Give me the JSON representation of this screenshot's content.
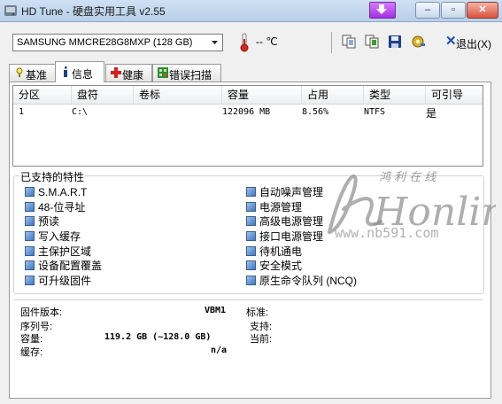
{
  "window": {
    "title": "HD Tune - 硬盘实用工具 v2.55",
    "caption_buttons": {
      "minimize": "–",
      "maximize": "▫",
      "close": "✕"
    }
  },
  "toolbar": {
    "drive": "SAMSUNG MMCRE28G8MXP (128 GB)",
    "temperature": "-- ℃",
    "exit_label": "退出(X)",
    "icons": [
      "copy-icon",
      "copy-all-icon",
      "save-icon",
      "options-icon"
    ]
  },
  "tabs": [
    {
      "label": "基准",
      "icon": "benchmark-icon"
    },
    {
      "label": "信息",
      "icon": "info-icon"
    },
    {
      "label": "健康",
      "icon": "health-icon"
    },
    {
      "label": "错误扫描",
      "icon": "error-scan-icon"
    }
  ],
  "partitions": {
    "headers": [
      "分区",
      "盘符",
      "卷标",
      "容量",
      "占用",
      "类型",
      "可引导"
    ],
    "rows": [
      [
        "1",
        "C:\\",
        "",
        "122096 MB",
        "8.56%",
        "NTFS",
        "是"
      ]
    ]
  },
  "features": {
    "title": "已支持的特性",
    "left": [
      "S.M.A.R.T",
      "48-位寻址",
      "预读",
      "写入缓存",
      "主保护区域",
      "设备配置覆盖",
      "可升级固件"
    ],
    "right": [
      "自动噪声管理",
      "电源管理",
      "高级电源管理",
      "接口电源管理",
      "待机通电",
      "安全模式",
      "原生命令队列 (NCQ)"
    ]
  },
  "details": {
    "firmware_label": "固件版本:",
    "firmware_value": "VBM1",
    "serial_label": "序列号:",
    "serial_value": "",
    "capacity_label": "容量:",
    "capacity_value": "119.2 GB (~128.0 GB)",
    "cache_label": "缓存:",
    "cache_value": "n/a",
    "standard_label": "标准:",
    "support_label": "支持:",
    "current_label": "当前:"
  },
  "watermark": {
    "brand": "Honline",
    "cn": "鸿 利 在 线",
    "url": "www.nb591.com"
  },
  "colors": {
    "titlebar": "#b7cfe9",
    "checkbox": "#3d78c4",
    "download_button": "#a32fe0"
  }
}
